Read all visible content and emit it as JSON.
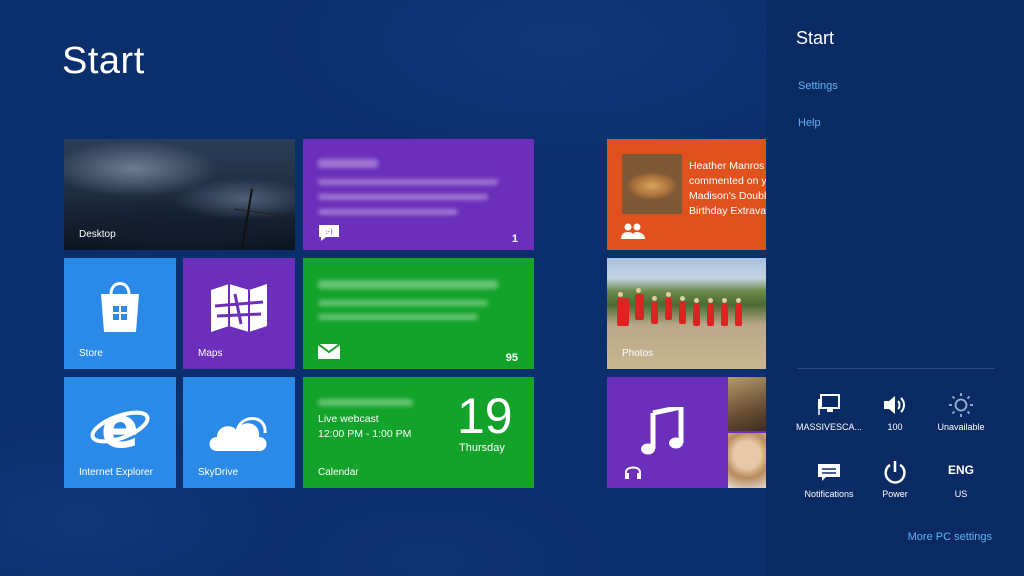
{
  "screen": {
    "title": "Start"
  },
  "tiles": {
    "desktop": {
      "label": "Desktop"
    },
    "messaging": {
      "count": "1"
    },
    "store": {
      "label": "Store"
    },
    "maps": {
      "label": "Maps"
    },
    "mail": {
      "count": "95"
    },
    "internet_explorer": {
      "label": "Internet Explorer"
    },
    "skydrive": {
      "label": "SkyDrive"
    },
    "calendar": {
      "event": "Live webcast",
      "time": "12:00 PM - 1:00 PM",
      "day_number": "19",
      "weekday": "Thursday",
      "label": "Calendar"
    },
    "people": {
      "line1": "Heather Manros",
      "line2": "commented on y",
      "line3": "Madison's Doubl",
      "line4": "Birthday Extrava"
    },
    "photos": {
      "label": "Photos"
    }
  },
  "charms": {
    "title": "Start",
    "links": {
      "settings": "Settings",
      "help": "Help"
    },
    "quick": {
      "network": "MASSIVESCA...",
      "volume": "100",
      "brightness": "Unavailable",
      "notifications": "Notifications",
      "power": "Power",
      "keyboard_top": "ENG",
      "keyboard_bottom": "US"
    },
    "more": "More PC settings"
  },
  "colors": {
    "background": "#0b2e6d",
    "purple": "#6b2fbb",
    "blue": "#2b8ae8",
    "green": "#14a32a",
    "orange": "#e0511e",
    "music_purple": "#6b2fbb",
    "charm_link": "#5fb4f3"
  }
}
